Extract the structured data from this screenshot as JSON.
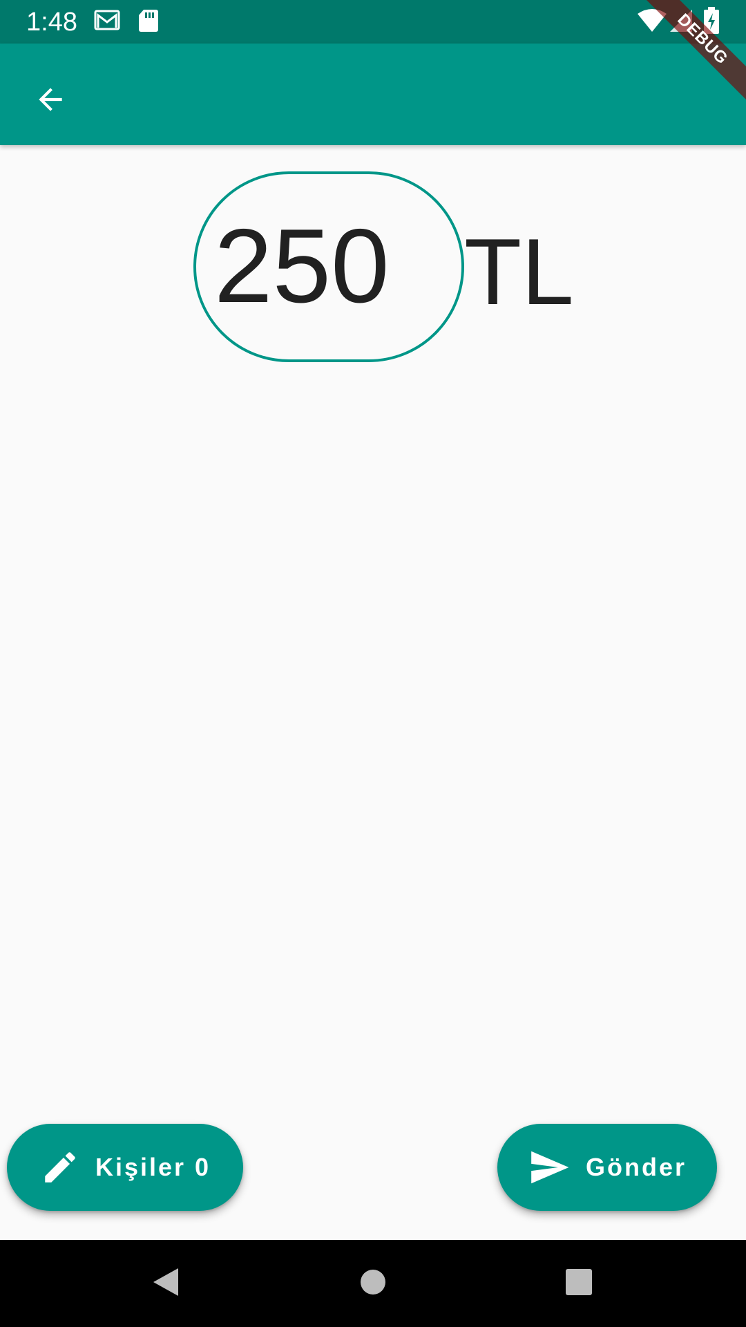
{
  "status_bar": {
    "time": "1:48",
    "icons": [
      "gmail-icon",
      "sd-card-icon",
      "wifi-icon",
      "signal-icon",
      "battery-charging-icon"
    ]
  },
  "debug_banner": {
    "label": "DEBUG"
  },
  "app_bar": {
    "back_icon": "arrow-back-icon"
  },
  "amount": {
    "value": "250",
    "currency": "TL"
  },
  "actions": {
    "contacts_label": "Kişiler 0",
    "contacts_icon": "pencil-icon",
    "send_label": "Gönder",
    "send_icon": "send-icon"
  },
  "nav_bar": {
    "buttons": [
      "back-triangle-icon",
      "home-circle-icon",
      "recents-square-icon"
    ]
  },
  "colors": {
    "primary": "#009688",
    "primary_dark": "#00796b",
    "background": "#fafafa",
    "text": "#212121"
  }
}
